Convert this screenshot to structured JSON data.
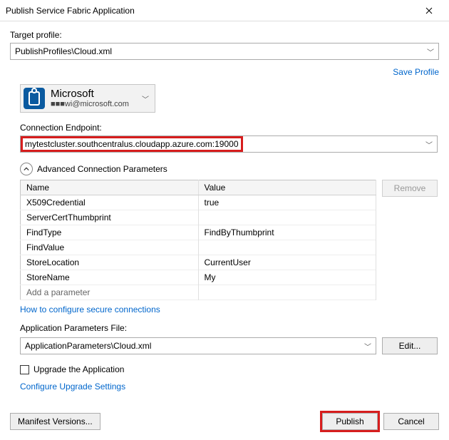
{
  "window": {
    "title": "Publish Service Fabric Application"
  },
  "targetProfile": {
    "label": "Target profile:",
    "value": "PublishProfiles\\Cloud.xml"
  },
  "saveProfile": "Save Profile",
  "account": {
    "name": "Microsoft",
    "detail": "■■■wi@microsoft.com"
  },
  "endpoint": {
    "label": "Connection Endpoint:",
    "value": "mytestcluster.southcentralus.cloudapp.azure.com:19000"
  },
  "advanced": {
    "title": "Advanced Connection Parameters",
    "cols": {
      "name": "Name",
      "value": "Value"
    },
    "rows": [
      {
        "name": "X509Credential",
        "value": "true"
      },
      {
        "name": "ServerCertThumbprint",
        "value": ""
      },
      {
        "name": "FindType",
        "value": "FindByThumbprint"
      },
      {
        "name": "FindValue",
        "value": ""
      },
      {
        "name": "StoreLocation",
        "value": "CurrentUser"
      },
      {
        "name": "StoreName",
        "value": "My"
      },
      {
        "name": "Add a parameter",
        "value": ""
      }
    ],
    "removeBtn": "Remove",
    "helpLink": "How to configure secure connections"
  },
  "appParams": {
    "label": "Application Parameters File:",
    "value": "ApplicationParameters\\Cloud.xml",
    "editBtn": "Edit..."
  },
  "upgrade": {
    "checkboxLabel": "Upgrade the Application",
    "settingsLink": "Configure Upgrade Settings"
  },
  "footer": {
    "manifestBtn": "Manifest Versions...",
    "publishBtn": "Publish",
    "cancelBtn": "Cancel"
  }
}
